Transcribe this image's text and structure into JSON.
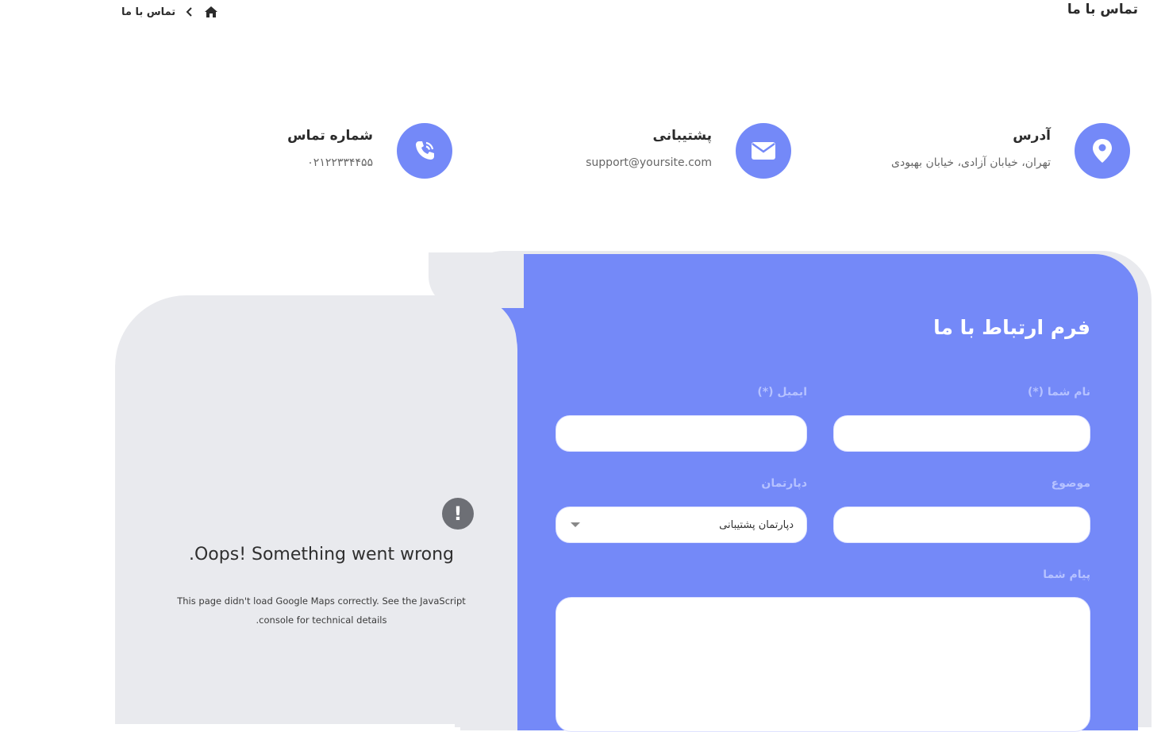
{
  "page": {
    "title": "تماس با ما"
  },
  "breadcrumb": {
    "current": "تماس با ما",
    "home_icon": "home-icon",
    "separator_icon": "chevron-left-icon"
  },
  "contact_info": [
    {
      "icon": "map-pin-icon",
      "title": "آدرس",
      "value": "تهران، خیابان آزادی، خیابان بهبودی"
    },
    {
      "icon": "mail-icon",
      "title": "پشتیبانی",
      "value": "support@yoursite.com"
    },
    {
      "icon": "phone-icon",
      "title": "شماره تماس",
      "value": "۰۲۱۲۲۳۳۴۴۵۵"
    }
  ],
  "map": {
    "error_icon": "exclamation-icon",
    "error_title": ".Oops! Something went wrong",
    "error_line1": "This page didn't load Google Maps correctly. See the JavaScript",
    "error_line2": ".console for technical details"
  },
  "form": {
    "title": "فرم ارتباط با ما",
    "name_label": "نام شما (*)",
    "email_label": "ایمیل (*)",
    "subject_label": "موضوع",
    "department_label": "دپارتمان",
    "department_selected": "دپارتمان پشتیبانی",
    "message_label": "پیام شما"
  },
  "colors": {
    "accent": "#7489f8",
    "panel_bg": "#e9eaee",
    "label": "#b6c2ff"
  }
}
